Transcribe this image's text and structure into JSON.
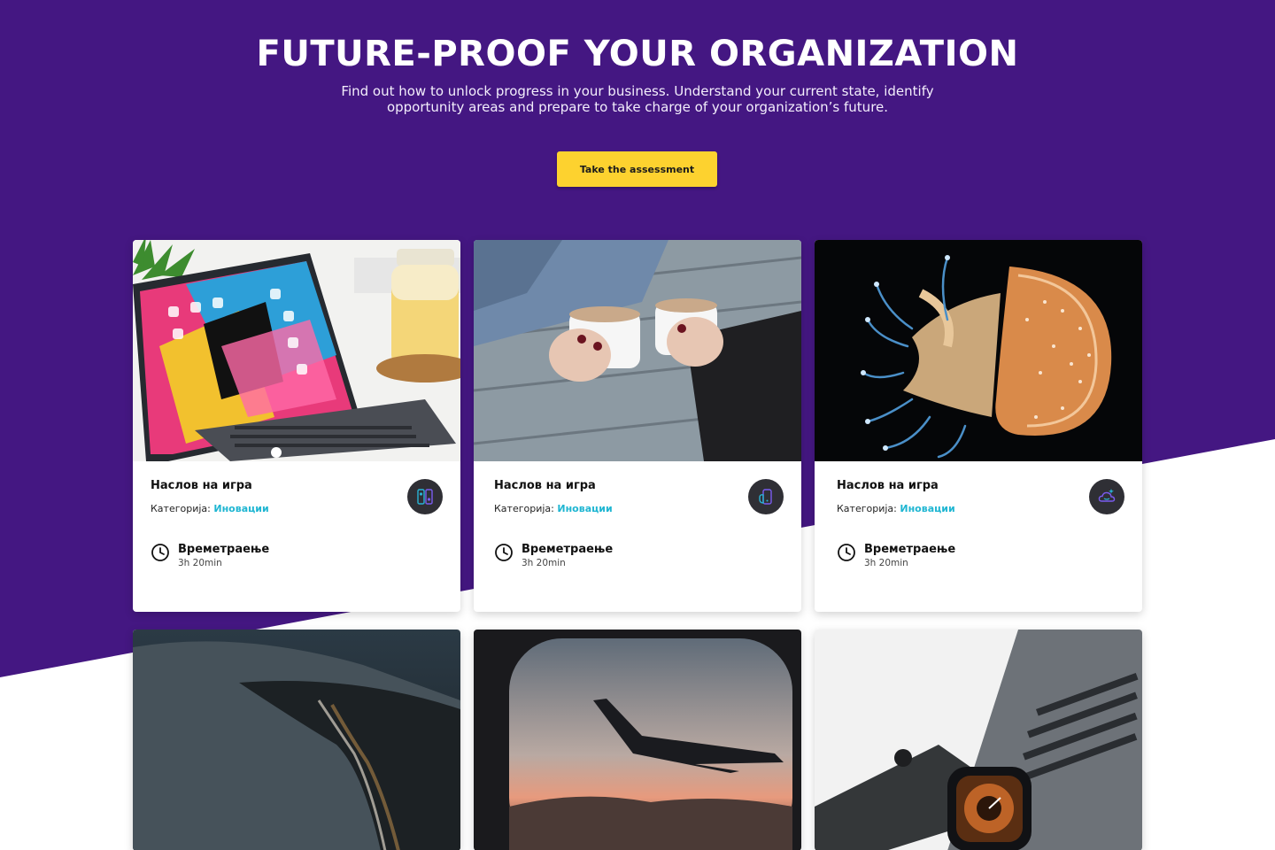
{
  "hero": {
    "title": "FUTURE-PROOF YOUR ORGANIZATION",
    "subtitle_line1": "Find out how to unlock progress in your business. Understand your current state, identify",
    "subtitle_line2": "opportunity areas and prepare to take charge of your organization’s future.",
    "cta_label": "Take the assessment"
  },
  "colors": {
    "background_purple": "#441782",
    "cta_yellow": "#fdd22f",
    "category_link": "#1fb6d2",
    "badge_dark": "#2f2f35"
  },
  "cards": [
    {
      "title": "Наслов на игра",
      "category_label": "Категорија:",
      "category_value": "Иновации",
      "duration_label": "Времетраење",
      "duration_value": "3h 20min",
      "image": "ipad-keyboard-photo",
      "badge_icon": "devices-icon"
    },
    {
      "title": "Наслов на игра",
      "category_label": "Категорија:",
      "category_value": "Иновации",
      "duration_label": "Времетраење",
      "duration_value": "3h 20min",
      "image": "coffee-cups-photo",
      "badge_icon": "hand-phone-icon"
    },
    {
      "title": "Наслов на игра",
      "category_label": "Категорија:",
      "category_value": "Иновации",
      "duration_label": "Времетраење",
      "duration_value": "3h 20min",
      "image": "jellyfish-photo",
      "badge_icon": "cloud-sparkle-icon"
    },
    {
      "image": "aerial-coast-photo"
    },
    {
      "image": "airplane-window-photo"
    },
    {
      "image": "laptop-watch-photo"
    }
  ]
}
